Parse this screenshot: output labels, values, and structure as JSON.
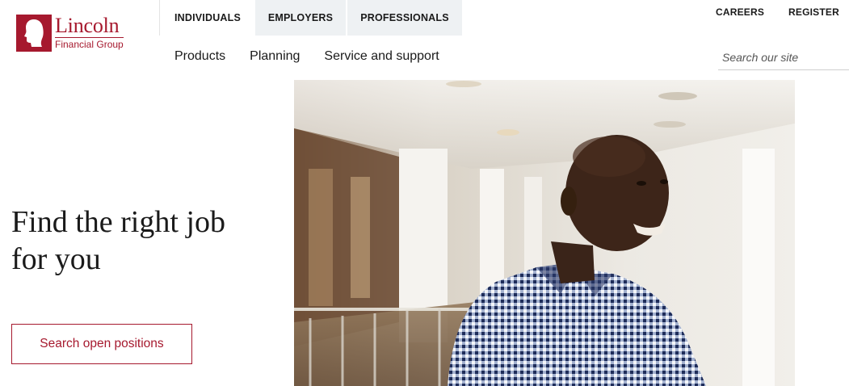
{
  "brand": {
    "name": "Lincoln",
    "subname": "Financial Group",
    "color": "#a6192e"
  },
  "segments": [
    {
      "label": "INDIVIDUALS",
      "active": true
    },
    {
      "label": "EMPLOYERS",
      "active": false
    },
    {
      "label": "PROFESSIONALS",
      "active": false
    }
  ],
  "main_nav": [
    {
      "label": "Products"
    },
    {
      "label": "Planning"
    },
    {
      "label": "Service and support"
    }
  ],
  "utility_nav": [
    {
      "label": "CAREERS"
    },
    {
      "label": "REGISTER"
    }
  ],
  "search": {
    "placeholder": "Search our site"
  },
  "hero": {
    "title_line1": "Find the right job",
    "title_line2": "for you",
    "cta_label": "Search open positions",
    "image_subject": "smiling man in gingham shirt in bright hallway"
  }
}
